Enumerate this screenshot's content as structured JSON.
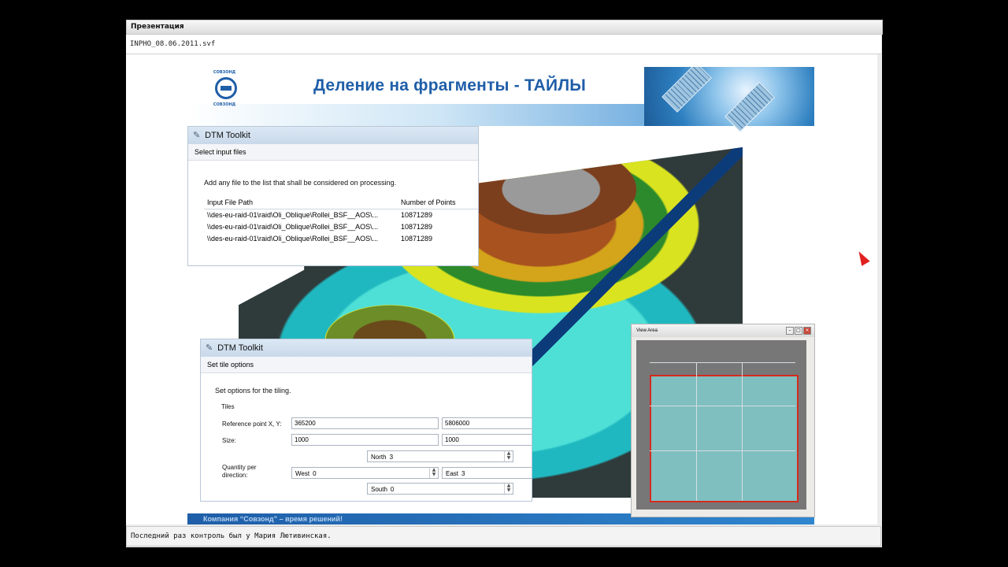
{
  "window": {
    "title": "Презентация",
    "file_name": "INPHO_08.06.2011.svf",
    "status": "Последний раз контроль был у Мария Лютивинская."
  },
  "slide": {
    "title": "Деление на фрагменты - ТАЙЛЫ",
    "logo_top": "СОВЗОНД",
    "logo_bottom": "СОВЗОНД",
    "footer": "Компания “Совзонд” – время решений!"
  },
  "dialog_files": {
    "title": "DTM Toolkit",
    "subtitle": "Select input files",
    "instruction": "Add any file to the list that shall be considered on processing.",
    "columns": [
      "Input File Path",
      "Number of Points"
    ],
    "rows": [
      [
        "\\\\des-eu-raid-01\\raid\\Oli_Oblique\\Rollei_BSF__AOS\\...",
        "10871289"
      ],
      [
        "\\\\des-eu-raid-01\\raid\\Oli_Oblique\\Rollei_BSF__AOS\\...",
        "10871289"
      ],
      [
        "\\\\des-eu-raid-01\\raid\\Oli_Oblique\\Rollei_BSF__AOS\\...",
        "10871289"
      ]
    ]
  },
  "dialog_tiles": {
    "title": "DTM Toolkit",
    "subtitle": "Set tile options",
    "instruction": "Set options for the tiling.",
    "group": "Tiles",
    "ref_label": "Reference point X, Y:",
    "ref_x": "365200",
    "ref_y": "5806000",
    "size_label": "Size:",
    "size_x": "1000",
    "size_y": "1000",
    "quantity_label_1": "Quantity per",
    "quantity_label_2": "direction:",
    "north_label": "North",
    "north_value": "3",
    "west_label": "West",
    "west_value": "0",
    "east_label": "East",
    "east_value": "3",
    "south_label": "South",
    "south_value": "0"
  },
  "view_area": {
    "title": "View Area"
  }
}
